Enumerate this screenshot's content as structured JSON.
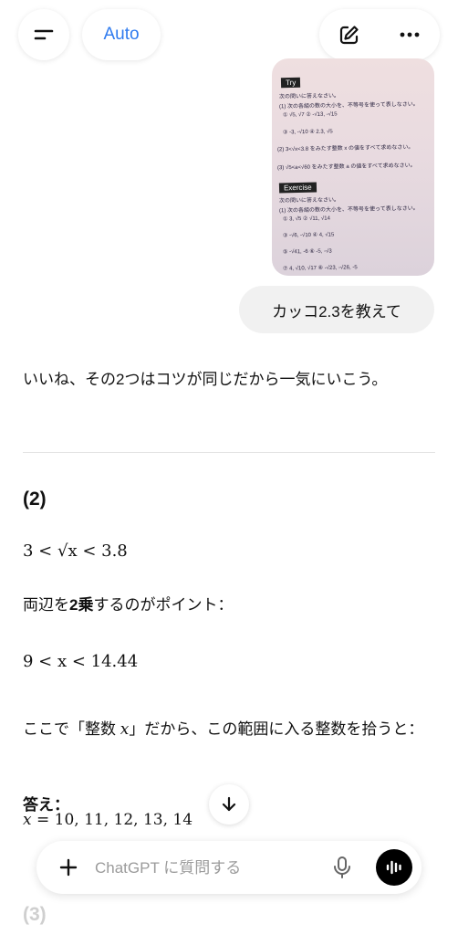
{
  "header": {
    "model_label": "Auto"
  },
  "photo": {
    "try_tag": "Try",
    "exercise_tag": "Exercise",
    "lines": [
      "次の問いに答えなさい。",
      "(1) 次の各組の数の大小を、不等号を使って表しなさい。",
      "① √5, √7        ② -√13, -√15",
      "③ -3, -√10       ④ 2.3, √5",
      "(2) 3<√x<3.8 をみたす整数 x の値をすべて求めなさい。",
      "(3) √5<a<√60 をみたす整数 a の値をすべて求めなさい。",
      "次の問いに答えなさい。",
      "(1) 次の各組の数の大小を、不等号を使って表しなさい。",
      "① 3, √5        ② √11, √14",
      "③ -√6, -√10      ④ 4, √15",
      "⑤ -√41, -6       ⑥ -5, -√3",
      "⑦ 4, √10, √17     ⑧ -√23, -√26, -5"
    ]
  },
  "messages": {
    "user_text": "カッコ2.3を教えて",
    "intro": "いいね、その2つはコツが同じだから一気にいこう。",
    "heading_2": "(2)",
    "ineq1": "3 < √x < 3.8",
    "p1_a": "両辺を",
    "p1_bold": "2乗",
    "p1_b": "するのがポイント：",
    "ineq2": "9 < x < 14.44",
    "p2_a": "ここで「整数 ",
    "p2_var": "x",
    "p2_b": "」だから、この範囲に入る整数を拾うと：",
    "answer_label": "答え：",
    "answer_lhs": "x",
    "answer_rhs": " = 10, 11, 12, 13, 14",
    "heading_3": "(3)"
  },
  "composer": {
    "placeholder": "ChatGPT に質問する"
  },
  "icons": {
    "menu": "menu-icon",
    "compose": "edit-icon",
    "more": "more-icon",
    "scroll": "arrow-down-icon",
    "plus": "plus-icon",
    "mic": "mic-icon",
    "voice": "voice-mode-icon"
  }
}
